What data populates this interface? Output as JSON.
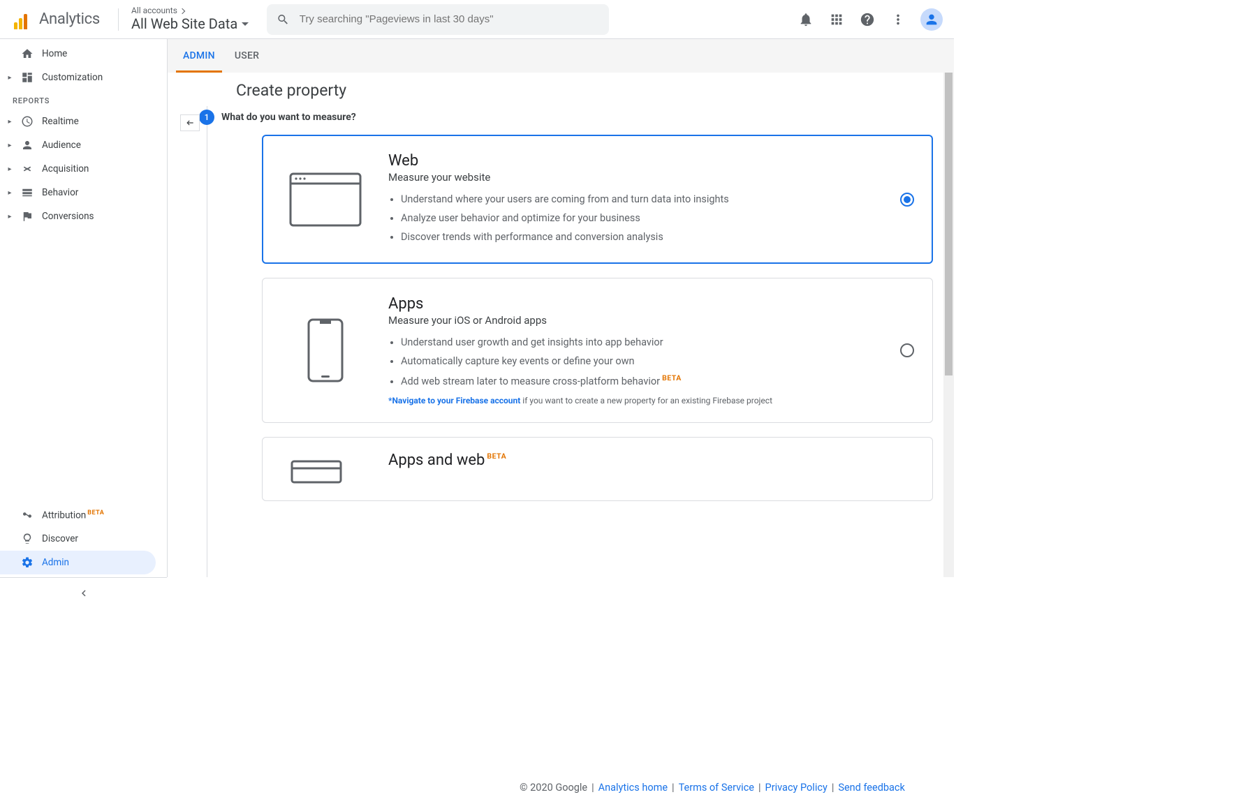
{
  "header": {
    "product": "Analytics",
    "accountTop": "All accounts",
    "accountBottom": "All Web Site Data",
    "searchPlaceholder": "Try searching \"Pageviews in last 30 days\""
  },
  "sidebar": {
    "home": "Home",
    "customization": "Customization",
    "reportsHeader": "REPORTS",
    "reports": [
      {
        "label": "Realtime",
        "icon": "clock"
      },
      {
        "label": "Audience",
        "icon": "person"
      },
      {
        "label": "Acquisition",
        "icon": "acq"
      },
      {
        "label": "Behavior",
        "icon": "behavior"
      },
      {
        "label": "Conversions",
        "icon": "flag"
      }
    ],
    "bottom": [
      {
        "label": "Attribution",
        "beta": "BETA",
        "icon": "attribution"
      },
      {
        "label": "Discover",
        "icon": "bulb"
      },
      {
        "label": "Admin",
        "icon": "gear",
        "active": true
      }
    ]
  },
  "tabs": [
    "ADMIN",
    "USER"
  ],
  "activeTab": 0,
  "page": {
    "title": "Create property",
    "stepNum": "1",
    "stepTitle": "What do you want to measure?"
  },
  "options": [
    {
      "title": "Web",
      "subtitle": "Measure your website",
      "bullets": [
        "Understand where your users are coming from and turn data into insights",
        "Analyze user behavior and optimize for your business",
        "Discover trends with performance and conversion analysis"
      ],
      "selected": true
    },
    {
      "title": "Apps",
      "subtitle": "Measure your iOS or Android apps",
      "bullets": [
        "Understand user growth and get insights into app behavior",
        "Automatically capture key events or define your own",
        "Add web stream later to measure cross-platform behavior"
      ],
      "bulletBeta": 2,
      "firebaseLink": "*Navigate to your Firebase account",
      "firebaseRest": " if you want to create a new property for an existing Firebase project",
      "selected": false
    },
    {
      "title": "Apps and web",
      "titleBeta": "BETA",
      "subtitle": "",
      "bullets": [],
      "selected": false
    }
  ],
  "footer": {
    "copyright": "© 2020 Google",
    "links": [
      "Analytics home",
      "Terms of Service",
      "Privacy Policy",
      "Send feedback"
    ]
  }
}
